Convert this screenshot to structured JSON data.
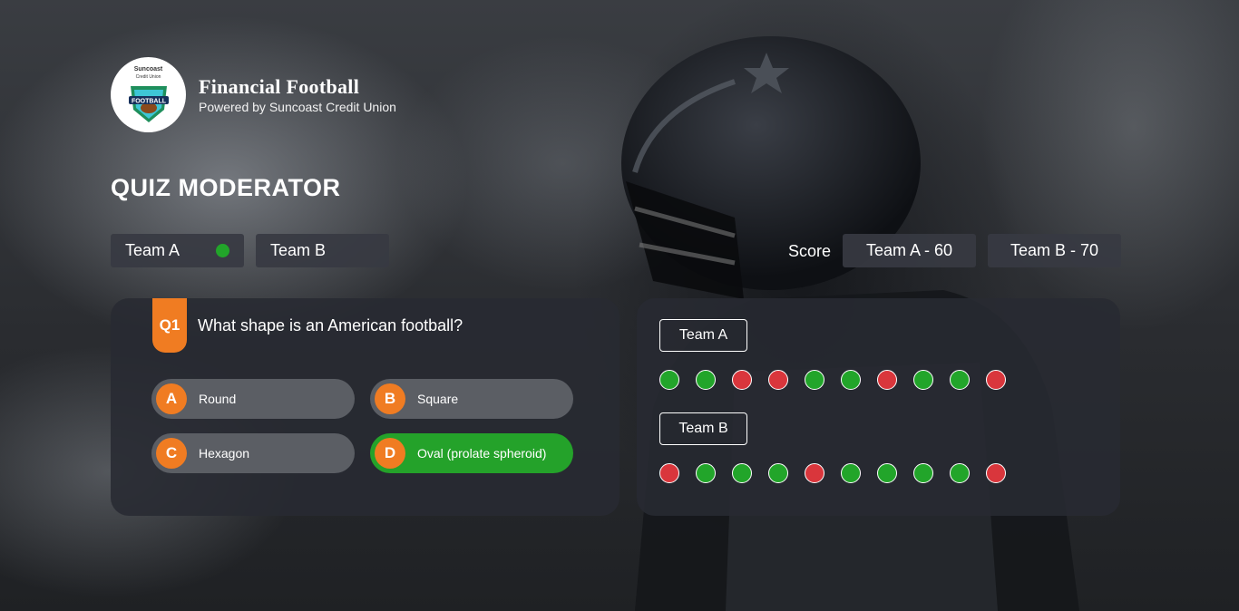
{
  "brand": {
    "logo_top_text": "Suncoast",
    "logo_sub_text": "Credit Union",
    "logo_badge_text": "FOOTBALL",
    "title": "Financial Football",
    "subtitle": "Powered by Suncoast Credit Union"
  },
  "page_title": "QUIZ MODERATOR",
  "teams": {
    "team_a_tab": "Team A",
    "team_b_tab": "Team B",
    "active_team": "Team A",
    "active_color": "#22a52a"
  },
  "score": {
    "label": "Score",
    "team_a": "Team A - 60",
    "team_b": "Team B - 70"
  },
  "question": {
    "tag": "Q1",
    "text": "What shape is an American football?",
    "options": [
      {
        "letter": "A",
        "text": "Round",
        "correct": false
      },
      {
        "letter": "B",
        "text": "Square",
        "correct": false
      },
      {
        "letter": "C",
        "text": "Hexagon",
        "correct": false
      },
      {
        "letter": "D",
        "text": "Oval (prolate spheroid)",
        "correct": true
      }
    ]
  },
  "results": {
    "team_a_label": "Team A",
    "team_b_label": "Team B",
    "team_a": [
      "correct",
      "correct",
      "wrong",
      "wrong",
      "correct",
      "correct",
      "wrong",
      "correct",
      "correct",
      "wrong"
    ],
    "team_b": [
      "wrong",
      "correct",
      "correct",
      "correct",
      "wrong",
      "correct",
      "correct",
      "correct",
      "correct",
      "wrong"
    ]
  },
  "colors": {
    "accent": "#f07c22",
    "correct": "#22a52a",
    "wrong": "#d9363c",
    "panel": "#282a32"
  }
}
